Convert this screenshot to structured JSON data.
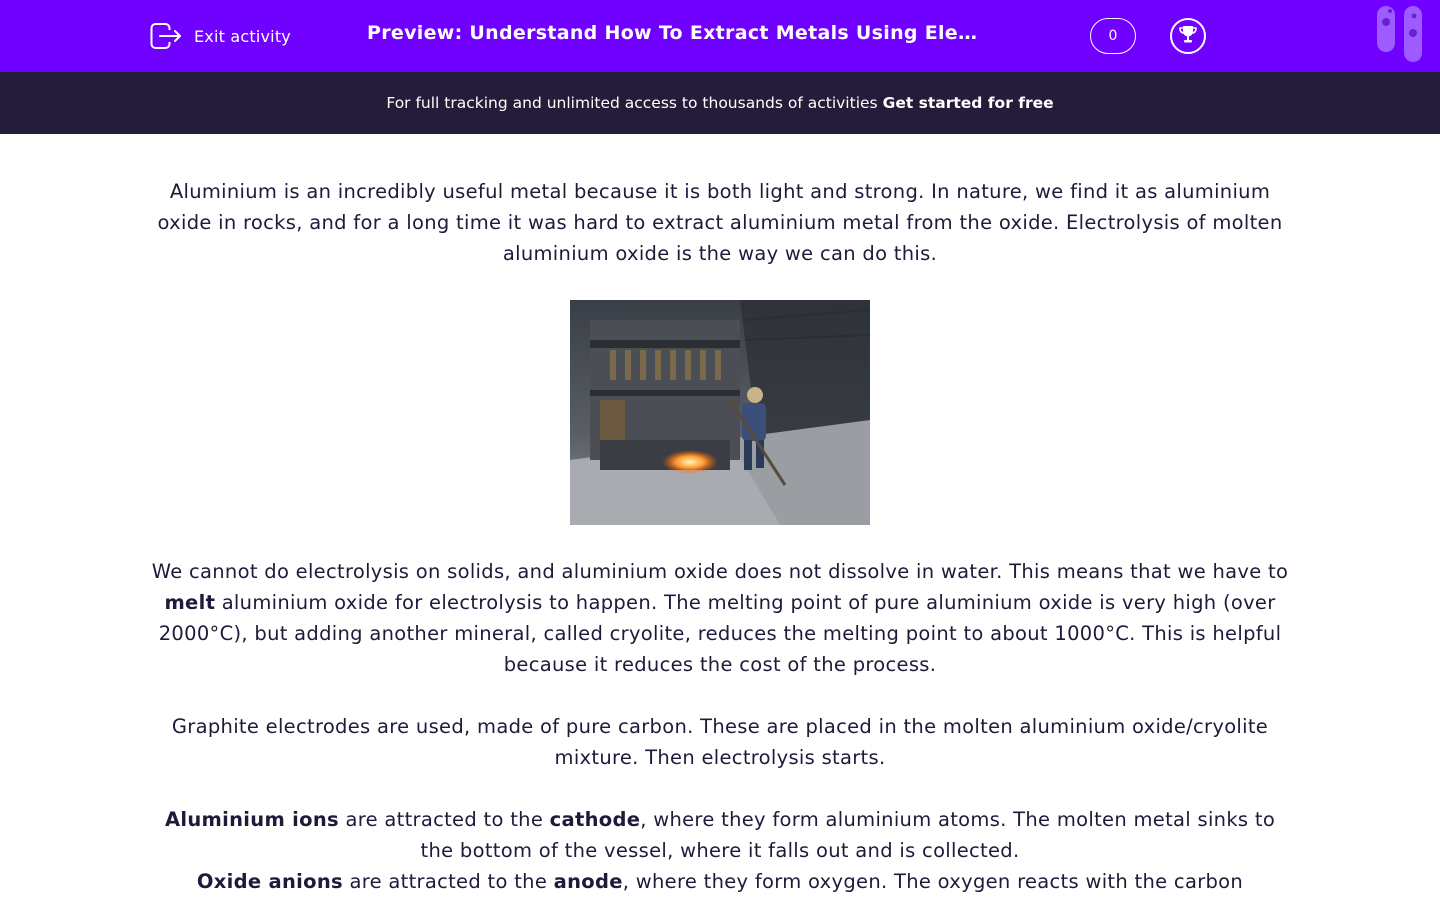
{
  "header": {
    "exit_label": "Exit activity",
    "title": "Preview: Understand How To Extract Metals Using Electrolysis",
    "score": "0",
    "colors": {
      "bar": "#7000ff",
      "promo": "#241c38",
      "text": "#1f1a3a"
    }
  },
  "promo": {
    "text": "For full tracking and unlimited access to thousands of activities",
    "cta": "Get started for free"
  },
  "content": {
    "p1": "Aluminium is an incredibly useful metal because it is both light and strong. In nature, we find it as aluminium oxide in rocks, and for a long time it was hard to extract aluminium metal from the oxide. Electrolysis of molten aluminium oxide is the way we can do this.",
    "p2": {
      "a": "We cannot do electrolysis on solids, and aluminium oxide does not dissolve in water. This means that we have to",
      "b": "melt",
      "c": "aluminium oxide for electrolysis to happen. The melting point of pure aluminium oxide is very high (over 2000°C), but adding another mineral, called cryolite, reduces the melting point to about 1000°C. This is helpful because it reduces the cost of the process."
    },
    "p3": "Graphite electrodes are used, made of pure carbon. These are placed in the molten aluminium oxide/cryolite mixture. Then electrolysis starts.",
    "p4": {
      "a": "Aluminium ions",
      "b": "are attracted to the",
      "c": "cathode",
      "d": ", where they form aluminium atoms. The molten metal sinks to the bottom of the vessel, where it falls out and is collected."
    },
    "p5": {
      "a": "Oxide anions",
      "b": "are attracted to the",
      "c": "anode",
      "d": ", where they form oxygen. The oxygen reacts with the carbon"
    }
  }
}
